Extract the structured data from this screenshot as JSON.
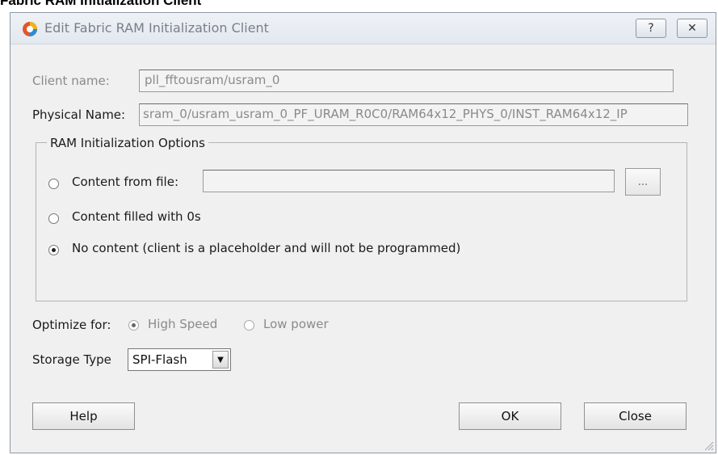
{
  "caption": "Fabric RAM Initialization Client",
  "window": {
    "title": "Edit Fabric RAM Initialization Client",
    "help_glyph": "?",
    "close_glyph": "✕"
  },
  "client_name": {
    "label": "Client name:",
    "value": "pll_fftousram/usram_0"
  },
  "physical_name": {
    "label": "Physical Name:",
    "value": "sram_0/usram_usram_0_PF_URAM_R0C0/RAM64x12_PHYS_0/INST_RAM64x12_IP"
  },
  "ram_options": {
    "title": "RAM Initialization Options",
    "content_from_file": {
      "label": "Content from file:",
      "value": "",
      "selected": false
    },
    "browse_label": "...",
    "content_zeros": {
      "label": "Content filled with 0s",
      "selected": false
    },
    "no_content": {
      "label": "No content (client is a placeholder and will not be programmed)",
      "selected": true
    }
  },
  "optimize": {
    "label": "Optimize for:",
    "high_speed": {
      "label": "High Speed",
      "selected": true
    },
    "low_power": {
      "label": "Low power",
      "selected": false
    }
  },
  "storage": {
    "label": "Storage Type",
    "value": "SPI-Flash"
  },
  "buttons": {
    "help": "Help",
    "ok": "OK",
    "close": "Close"
  }
}
